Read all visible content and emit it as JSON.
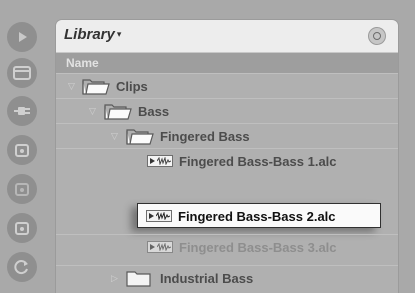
{
  "browser": {
    "title": "Library",
    "title_caret": "▾",
    "column_name": "Name",
    "search_icon": "magnifier-icon"
  },
  "sidebar": {
    "icons": [
      "play-icon",
      "window-icon",
      "plug-icon",
      "folder-icon-1",
      "folder-icon-2",
      "folder-icon-3",
      "refresh-icon"
    ]
  },
  "tree": {
    "clips": "Clips",
    "bass": "Bass",
    "fingered_bass": "Fingered Bass",
    "file1": "Fingered Bass-Bass 1.alc",
    "file2": "Fingered Bass-Bass 2.alc",
    "file3": "Fingered Bass-Bass 3.alc",
    "industrial_bass": "Industrial Bass"
  },
  "tree_toggles": {
    "expanded": "▽",
    "collapsed": "▷"
  },
  "colors": {
    "background": "#a9a9a9",
    "panel": "#b0b0b0",
    "header": "#ededed",
    "selection": "#fafafa"
  }
}
